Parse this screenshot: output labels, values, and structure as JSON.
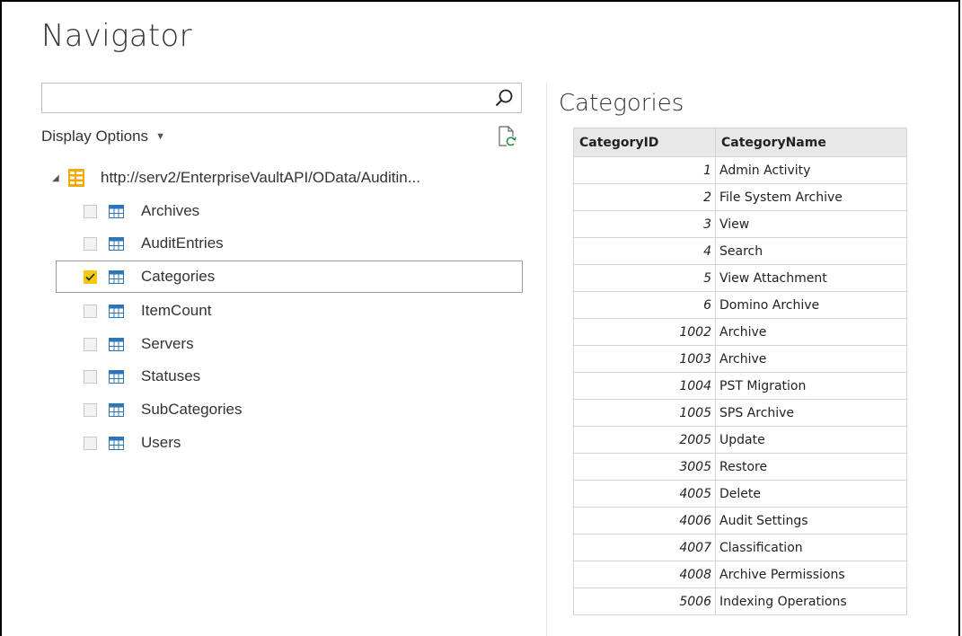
{
  "window": {
    "title": "Navigator"
  },
  "search": {
    "value": "",
    "placeholder": ""
  },
  "display_options": {
    "label": "Display Options"
  },
  "tree": {
    "root_label": "http://serv2/EnterpriseVaultAPI/OData/Auditin...",
    "items": [
      {
        "label": "Archives",
        "checked": false
      },
      {
        "label": "AuditEntries",
        "checked": false
      },
      {
        "label": "Categories",
        "checked": true
      },
      {
        "label": "ItemCount",
        "checked": false
      },
      {
        "label": "Servers",
        "checked": false
      },
      {
        "label": "Statuses",
        "checked": false
      },
      {
        "label": "SubCategories",
        "checked": false
      },
      {
        "label": "Users",
        "checked": false
      }
    ]
  },
  "preview": {
    "title": "Categories",
    "columns": [
      "CategoryID",
      "CategoryName"
    ],
    "rows": [
      [
        "1",
        "Admin Activity"
      ],
      [
        "2",
        "File System Archive"
      ],
      [
        "3",
        "View"
      ],
      [
        "4",
        "Search"
      ],
      [
        "5",
        "View Attachment"
      ],
      [
        "6",
        "Domino Archive"
      ],
      [
        "1002",
        "Archive"
      ],
      [
        "1003",
        "Archive"
      ],
      [
        "1004",
        "PST Migration"
      ],
      [
        "1005",
        "SPS Archive"
      ],
      [
        "2005",
        "Update"
      ],
      [
        "3005",
        "Restore"
      ],
      [
        "4005",
        "Delete"
      ],
      [
        "4006",
        "Audit Settings"
      ],
      [
        "4007",
        "Classification"
      ],
      [
        "4008",
        "Archive Permissions"
      ],
      [
        "5006",
        "Indexing Operations"
      ]
    ]
  },
  "colors": {
    "checkbox_checked": "#f2c811",
    "table_icon": "#2e75b6",
    "db_icon": "#f2a900"
  }
}
